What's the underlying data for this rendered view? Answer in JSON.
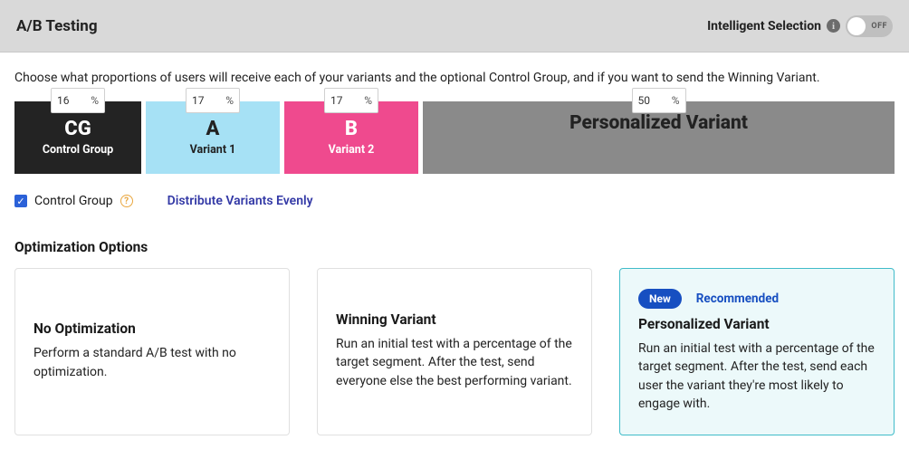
{
  "header": {
    "title": "A/B Testing",
    "toggle_label": "Intelligent Selection",
    "toggle_state": "OFF"
  },
  "description": "Choose what proportions of users will receive each of your variants and the optional Control Group, and if you want to send the Winning Variant.",
  "tiles": {
    "cg": {
      "pct": "16",
      "big": "CG",
      "small": "Control Group"
    },
    "a": {
      "pct": "17",
      "big": "A",
      "small": "Variant 1"
    },
    "b": {
      "pct": "17",
      "big": "B",
      "small": "Variant 2"
    },
    "pv": {
      "pct": "50",
      "big": "Personalized Variant"
    }
  },
  "controls": {
    "control_group_label": "Control Group",
    "distribute_label": "Distribute Variants Evenly"
  },
  "optimization": {
    "heading": "Optimization Options",
    "cards": {
      "none": {
        "title": "No Optimization",
        "body": "Perform a standard A/B test with no optimization."
      },
      "winning": {
        "title": "Winning Variant",
        "body": "Run an initial test with a percentage of the target segment. After the test, send everyone else the best performing variant."
      },
      "personalized": {
        "badge": "New",
        "recommended": "Recommended",
        "title": "Personalized Variant",
        "body": "Run an initial test with a percentage of the target segment. After the test, send each user the variant they're most likely to engage with."
      }
    }
  }
}
